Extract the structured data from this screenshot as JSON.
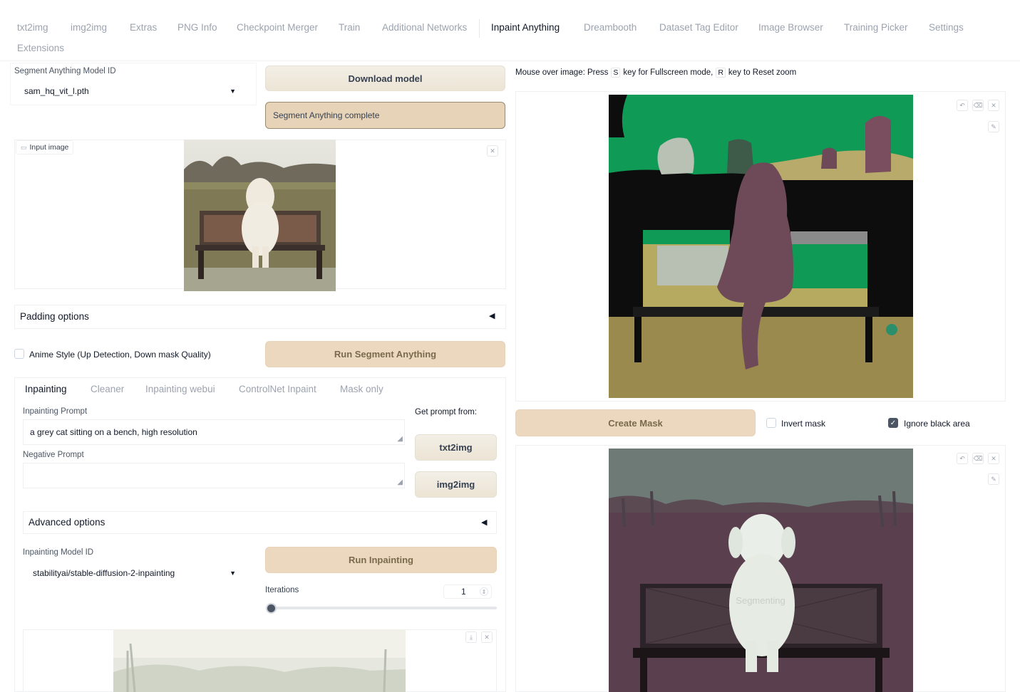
{
  "tabs": [
    "txt2img",
    "img2img",
    "Extras",
    "PNG Info",
    "Checkpoint Merger",
    "Train",
    "Additional Networks",
    "Inpaint Anything",
    "Dreambooth",
    "Dataset Tag Editor",
    "Image Browser",
    "Training Picker",
    "Settings",
    "Extensions"
  ],
  "active_tab": "Inpaint Anything",
  "segment": {
    "model_label": "Segment Anything Model ID",
    "model_value": "sam_hq_vit_l.pth",
    "download_label": "Download model",
    "status_text": "Segment Anything complete",
    "input_image_label": "Input image",
    "padding_options_label": "Padding options",
    "anime_style_label": "Anime Style (Up Detection, Down mask Quality)",
    "run_label": "Run Segment Anything"
  },
  "inpaint_tabs": [
    "Inpainting",
    "Cleaner",
    "Inpainting webui",
    "ControlNet Inpaint",
    "Mask only"
  ],
  "inpainting": {
    "prompt_label": "Inpainting Prompt",
    "prompt_value": "a grey cat sitting on a bench, high resolution",
    "negative_label": "Negative Prompt",
    "negative_value": "",
    "get_prompt_label": "Get prompt from:",
    "txt2img_btn": "txt2img",
    "img2img_btn": "img2img",
    "advanced_label": "Advanced options",
    "model_label": "Inpainting Model ID",
    "model_value": "stabilityai/stable-diffusion-2-inpainting",
    "run_label": "Run Inpainting",
    "iterations_label": "Iterations",
    "iterations_value": "1",
    "iterations_fraction": 0.0
  },
  "right": {
    "hint_prefix": "Mouse over image: Press",
    "key_s": "S",
    "hint_mid": "key for Fullscreen mode,",
    "key_r": "R",
    "hint_suffix": "key to Reset zoom",
    "create_mask_label": "Create Mask",
    "invert_mask_label": "Invert mask",
    "invert_mask_checked": false,
    "ignore_black_label": "Ignore black area",
    "ignore_black_checked": true,
    "overlay_text": "Segmenting"
  },
  "colors": {
    "accent_peach": "#ecd8bf",
    "seg_green": "#0f9a55",
    "seg_black": "#0e0e0e",
    "seg_olive": "#9a8a4e",
    "seg_maroon": "#6e4a58"
  }
}
